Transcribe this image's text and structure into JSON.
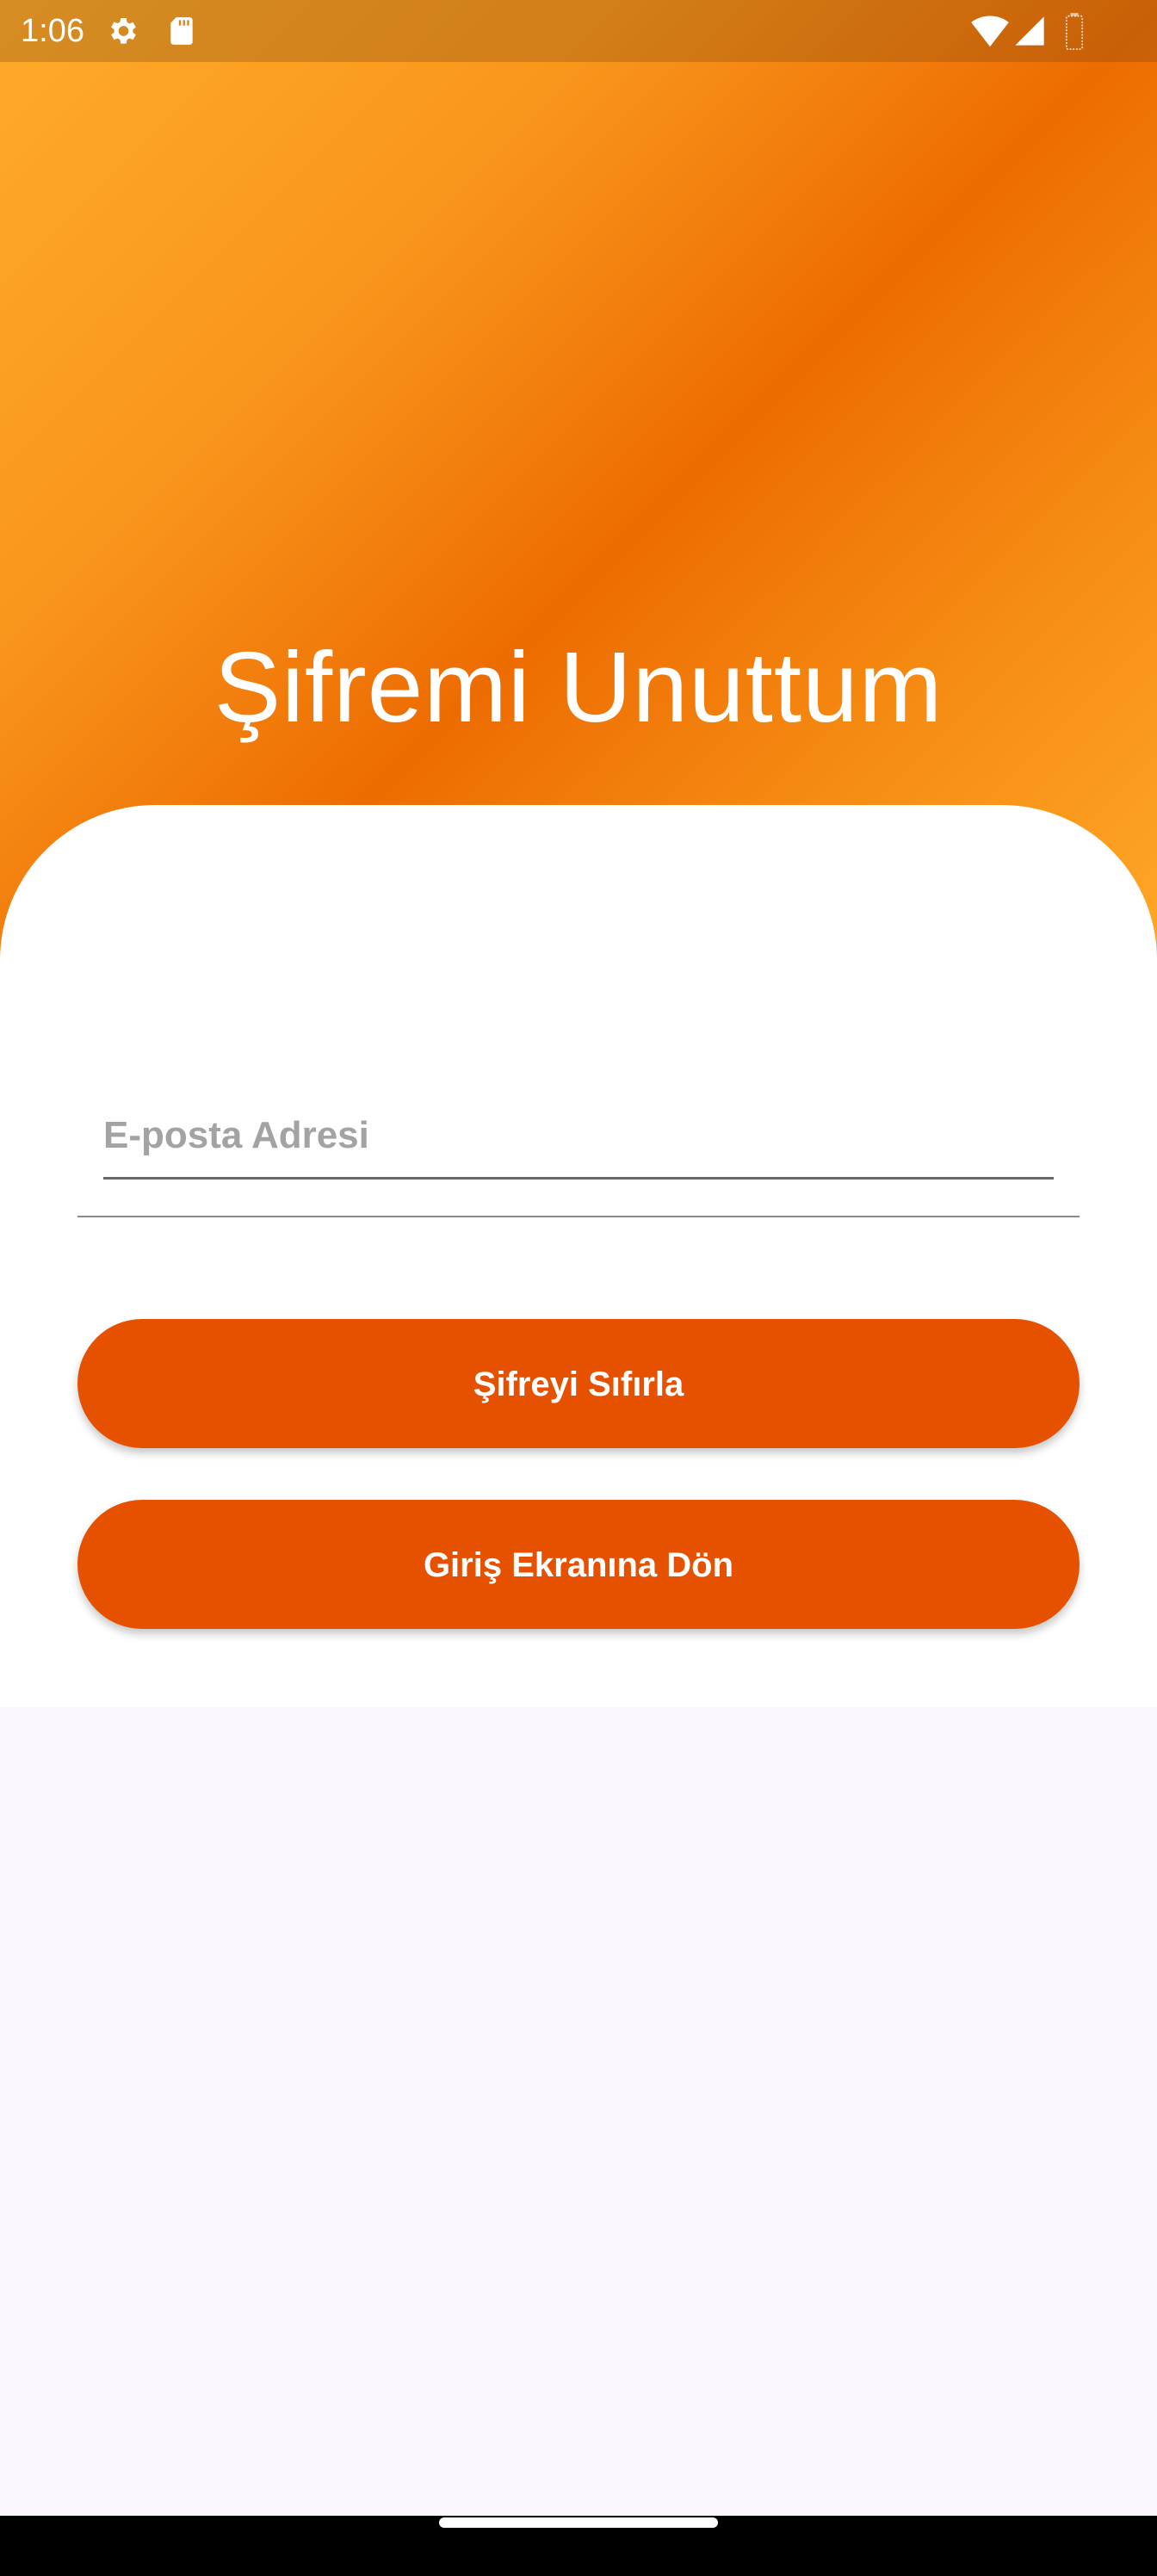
{
  "status_bar": {
    "time": "1:06",
    "icons": [
      "gear-icon",
      "sd-card-icon",
      "wifi-icon",
      "signal-icon",
      "battery-icon"
    ]
  },
  "screen": {
    "title": "Şifremi Unuttum"
  },
  "form": {
    "email_placeholder": "E-posta Adresi",
    "email_value": ""
  },
  "buttons": {
    "reset_label": "Şifreyi Sıfırla",
    "back_label": "Giriş Ekranına Dön"
  },
  "colors": {
    "accent": "#e65100",
    "gradient_light": "#ffab2b",
    "gradient_dark": "#ed6c02",
    "card_background": "#ffffff",
    "page_background": "#fcf6fe"
  }
}
